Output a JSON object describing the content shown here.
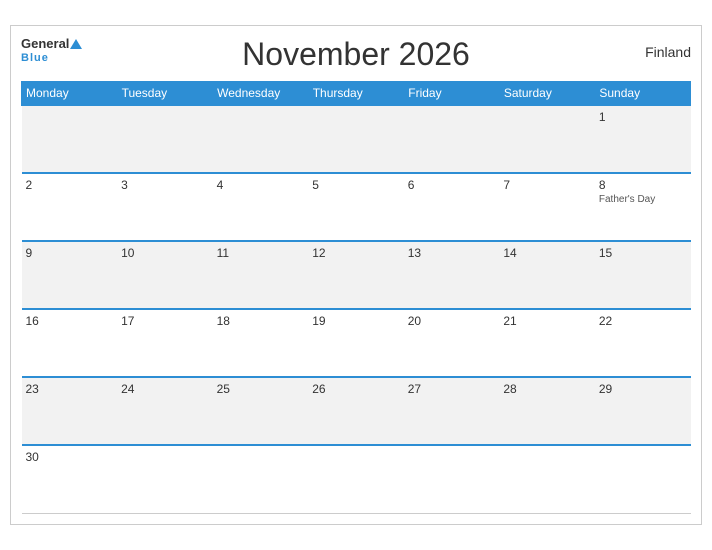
{
  "header": {
    "title": "November 2026",
    "country": "Finland",
    "logo_general": "General",
    "logo_blue": "Blue"
  },
  "weekdays": [
    "Monday",
    "Tuesday",
    "Wednesday",
    "Thursday",
    "Friday",
    "Saturday",
    "Sunday"
  ],
  "weeks": [
    {
      "days": [
        {
          "num": "",
          "event": "",
          "empty": true
        },
        {
          "num": "",
          "event": "",
          "empty": true
        },
        {
          "num": "",
          "event": "",
          "empty": true
        },
        {
          "num": "",
          "event": "",
          "empty": true
        },
        {
          "num": "",
          "event": "",
          "empty": true
        },
        {
          "num": "",
          "event": "",
          "empty": true
        },
        {
          "num": "1",
          "event": ""
        }
      ]
    },
    {
      "days": [
        {
          "num": "2",
          "event": ""
        },
        {
          "num": "3",
          "event": ""
        },
        {
          "num": "4",
          "event": ""
        },
        {
          "num": "5",
          "event": ""
        },
        {
          "num": "6",
          "event": ""
        },
        {
          "num": "7",
          "event": ""
        },
        {
          "num": "8",
          "event": "Father's Day"
        }
      ]
    },
    {
      "days": [
        {
          "num": "9",
          "event": ""
        },
        {
          "num": "10",
          "event": ""
        },
        {
          "num": "11",
          "event": ""
        },
        {
          "num": "12",
          "event": ""
        },
        {
          "num": "13",
          "event": ""
        },
        {
          "num": "14",
          "event": ""
        },
        {
          "num": "15",
          "event": ""
        }
      ]
    },
    {
      "days": [
        {
          "num": "16",
          "event": ""
        },
        {
          "num": "17",
          "event": ""
        },
        {
          "num": "18",
          "event": ""
        },
        {
          "num": "19",
          "event": ""
        },
        {
          "num": "20",
          "event": ""
        },
        {
          "num": "21",
          "event": ""
        },
        {
          "num": "22",
          "event": ""
        }
      ]
    },
    {
      "days": [
        {
          "num": "23",
          "event": ""
        },
        {
          "num": "24",
          "event": ""
        },
        {
          "num": "25",
          "event": ""
        },
        {
          "num": "26",
          "event": ""
        },
        {
          "num": "27",
          "event": ""
        },
        {
          "num": "28",
          "event": ""
        },
        {
          "num": "29",
          "event": ""
        }
      ]
    },
    {
      "days": [
        {
          "num": "30",
          "event": ""
        },
        {
          "num": "",
          "event": "",
          "empty": true
        },
        {
          "num": "",
          "event": "",
          "empty": true
        },
        {
          "num": "",
          "event": "",
          "empty": true
        },
        {
          "num": "",
          "event": "",
          "empty": true
        },
        {
          "num": "",
          "event": "",
          "empty": true
        },
        {
          "num": "",
          "event": "",
          "empty": true
        }
      ]
    }
  ]
}
